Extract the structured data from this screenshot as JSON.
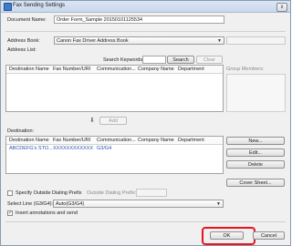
{
  "window": {
    "title": "Fax Sending Settings",
    "close_glyph": "x"
  },
  "document": {
    "label": "Document Name:",
    "value": "Order Form_Sample 20150101125534"
  },
  "address_book": {
    "label": "Address Book:",
    "selected": "Canon Fax Driver Address Book"
  },
  "address_list": {
    "label": "Address List:",
    "search_label": "Search Keywords:",
    "search_button": "Search",
    "clear_button": "Clear",
    "columns": [
      "Destination Name",
      "Fax Number/URI",
      "Communication...",
      "Company Name",
      "Department"
    ],
    "group_members_label": "Group Members:"
  },
  "add_button": "Add",
  "destination": {
    "label": "Destination:",
    "columns": [
      "Destination Name",
      "Fax Number/URI",
      "Communication...",
      "Company Name",
      "Department"
    ],
    "rows": [
      {
        "name": "ABCDEFG's STO...",
        "fax": "XXXXXXXXXXXX",
        "comm": "G3/G4",
        "company": "",
        "department": ""
      }
    ]
  },
  "side_buttons": {
    "new": "New...",
    "edit": "Edit...",
    "delete": "Delete",
    "cover_sheet": "Cover Sheet..."
  },
  "outside_prefix": {
    "checkbox_label": "Specify Outside Dialing Prefix",
    "field_label": "Outside Dialing Prefix:",
    "value": ""
  },
  "select_line": {
    "label": "Select Line (G3/G4):",
    "selected": "Auto(G3/G4)"
  },
  "insert_annotations": {
    "label": "Insert annotations and send",
    "checked": true,
    "check_glyph": "✓"
  },
  "footer": {
    "ok": "OK",
    "cancel": "Cancel"
  },
  "colors": {
    "highlight": "#e8141d",
    "link_text": "#2a4fa8"
  },
  "icons": {
    "add_arrow": "down-arrow-icon",
    "dropdown": "chevron-down-icon"
  }
}
